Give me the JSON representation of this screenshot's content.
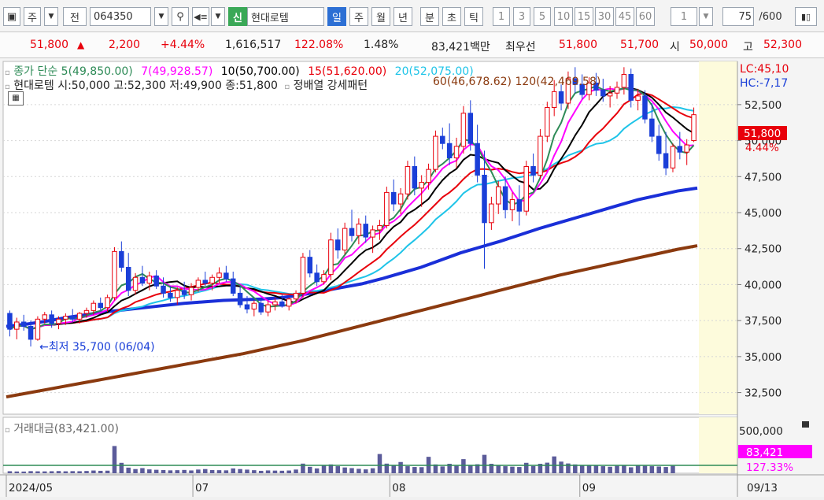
{
  "toolbar": {
    "market_label": "주",
    "jeon_label": "전",
    "code_value": "064350",
    "new_badge": "신",
    "stock_name": "현대로템",
    "periods": [
      "일",
      "주",
      "월",
      "년"
    ],
    "active_period": "일",
    "intraday": [
      "분",
      "초",
      "틱"
    ],
    "intervals": [
      "1",
      "3",
      "5",
      "10",
      "15",
      "30",
      "45",
      "60"
    ],
    "multiplier": "1",
    "count_value": "75",
    "count_total": "/600"
  },
  "quote": {
    "price": "51,800",
    "up_arrow": "▲",
    "change": "2,200",
    "change_pct": "+4.44%",
    "volume": "1,616,517",
    "vol_ratio": "122.08%",
    "turnover": "1.48%",
    "amount": "83,421백만",
    "priority_label": "최우선",
    "ask": "51,800",
    "bid": "51,700",
    "open_label": "시",
    "open": "50,000",
    "high_label": "고",
    "high": "52,300"
  },
  "legend": {
    "ma_prefix": "종가 단순",
    "ma5": "5(49,850.00)",
    "ma7": "7(49,928.57)",
    "ma10": "10(50,700.00)",
    "ma15": "15(51,620.00)",
    "ma20": "20(52,075.00)",
    "ohlc_line": "현대로템 시:50,000 고:52,300 저:49,900 종:51,800",
    "pattern_label": "정배열 강세패턴",
    "overlap_text": "60(46,678.62) 120(42,469.58)",
    "lc": "LC:45,10",
    "hc": "HC:-7,17",
    "low_annotation": "←최저 35,700 (06/04)",
    "volume_legend": "거래대금(83,421.00)"
  },
  "price_tag": {
    "value": "51,800",
    "pct": "4.44%"
  },
  "volume_tag": {
    "value": "83,421",
    "pct": "127.33%"
  },
  "axis": {
    "price_ticks": [
      "52,500",
      "50,000",
      "47,500",
      "45,000",
      "42,500",
      "40,000",
      "37,500",
      "35,000",
      "32,500"
    ],
    "volume_tick": "500,000",
    "x_ticks": [
      "2024/05",
      "07",
      "08",
      "09",
      "09/13"
    ]
  },
  "colors": {
    "up": "#e8000b",
    "down": "#1a3fd8",
    "ma5": "#2e8b57",
    "ma7": "#ff00ff",
    "ma10": "#000000",
    "ma15": "#e8000b",
    "ma20": "#1fc4e8",
    "ma60": "#1a2fd8",
    "ma120": "#8b3a0f",
    "volume": "#5b5b9a"
  },
  "chart_data": {
    "type": "candlestick",
    "x_labels": [
      "2024/05",
      "07",
      "08",
      "09",
      "09/13"
    ],
    "ylim": [
      31000,
      55500
    ],
    "price_ticks": [
      32500,
      35000,
      37500,
      40000,
      42500,
      45000,
      47500,
      50000,
      52500
    ],
    "last_candle": {
      "open": 50000,
      "high": 52300,
      "low": 49900,
      "close": 51800
    },
    "low_point": {
      "value": 35700,
      "date": "06/04"
    },
    "ma_last": {
      "ma5": 49850,
      "ma7": 49928.57,
      "ma10": 50700,
      "ma15": 51620,
      "ma20": 52075,
      "ma60": 46678.62,
      "ma120": 42469.58
    },
    "candles": [
      [
        38000,
        38200,
        36400,
        36900
      ],
      [
        36900,
        37700,
        36200,
        37400
      ],
      [
        37400,
        37900,
        36800,
        37100
      ],
      [
        37100,
        37500,
        35700,
        36200
      ],
      [
        36200,
        37800,
        36100,
        37600
      ],
      [
        37600,
        38100,
        37300,
        37900
      ],
      [
        37900,
        38200,
        37000,
        37300
      ],
      [
        37300,
        37800,
        36900,
        37600
      ],
      [
        37600,
        38000,
        37200,
        37800
      ],
      [
        37800,
        38300,
        37400,
        37600
      ],
      [
        37600,
        38100,
        37300,
        38000
      ],
      [
        38000,
        38400,
        37700,
        38200
      ],
      [
        38200,
        38900,
        37900,
        38700
      ],
      [
        38700,
        39100,
        38200,
        38400
      ],
      [
        38400,
        39300,
        38100,
        39100
      ],
      [
        39100,
        42600,
        38900,
        42300
      ],
      [
        42300,
        43000,
        40900,
        41200
      ],
      [
        41200,
        42200,
        39200,
        39600
      ],
      [
        39600,
        40800,
        39300,
        40500
      ],
      [
        40500,
        41300,
        39900,
        40100
      ],
      [
        40100,
        40900,
        39600,
        40600
      ],
      [
        40600,
        41000,
        39700,
        39900
      ],
      [
        39900,
        40500,
        39100,
        39400
      ],
      [
        39400,
        39900,
        38800,
        39100
      ],
      [
        39100,
        39800,
        38600,
        39600
      ],
      [
        39600,
        40200,
        39000,
        39300
      ],
      [
        39300,
        40100,
        38900,
        39800
      ],
      [
        39800,
        40500,
        39500,
        40300
      ],
      [
        40300,
        40900,
        39900,
        40100
      ],
      [
        40100,
        40700,
        39600,
        40500
      ],
      [
        40500,
        41200,
        40100,
        40800
      ],
      [
        40800,
        41300,
        40200,
        40400
      ],
      [
        40400,
        40900,
        39200,
        39400
      ],
      [
        39400,
        39900,
        38400,
        38600
      ],
      [
        38600,
        39200,
        38000,
        38300
      ],
      [
        38300,
        38900,
        37800,
        38700
      ],
      [
        38700,
        39100,
        37900,
        38100
      ],
      [
        38100,
        38900,
        37800,
        38600
      ],
      [
        38600,
        39100,
        38200,
        38800
      ],
      [
        38800,
        39300,
        38400,
        38500
      ],
      [
        38500,
        39100,
        38200,
        39000
      ],
      [
        39000,
        39600,
        38700,
        39400
      ],
      [
        39400,
        42200,
        39100,
        41900
      ],
      [
        41900,
        42400,
        40500,
        40800
      ],
      [
        40800,
        41400,
        39900,
        40200
      ],
      [
        40200,
        41000,
        40000,
        40700
      ],
      [
        40700,
        43600,
        40300,
        43100
      ],
      [
        43100,
        43900,
        41800,
        42400
      ],
      [
        42400,
        44300,
        42100,
        43900
      ],
      [
        43900,
        45200,
        43000,
        43400
      ],
      [
        43400,
        44600,
        42800,
        44200
      ],
      [
        44200,
        44800,
        42900,
        43300
      ],
      [
        43300,
        44100,
        42200,
        43800
      ],
      [
        43800,
        44500,
        43100,
        44100
      ],
      [
        44100,
        46800,
        43900,
        46400
      ],
      [
        46400,
        47300,
        45100,
        45600
      ],
      [
        45600,
        46700,
        44900,
        46300
      ],
      [
        46300,
        48600,
        45900,
        48200
      ],
      [
        48200,
        48900,
        46200,
        46700
      ],
      [
        46700,
        47600,
        45400,
        47100
      ],
      [
        47100,
        48400,
        46600,
        48000
      ],
      [
        48000,
        50700,
        47800,
        50300
      ],
      [
        50300,
        50900,
        49400,
        49800
      ],
      [
        49800,
        51200,
        48300,
        48800
      ],
      [
        48800,
        50200,
        48100,
        49600
      ],
      [
        49600,
        52400,
        49100,
        51900
      ],
      [
        51900,
        52800,
        49300,
        49800
      ],
      [
        49800,
        51100,
        47100,
        47600
      ],
      [
        47600,
        49300,
        41100,
        44300
      ],
      [
        44300,
        46100,
        43800,
        45600
      ],
      [
        45600,
        47200,
        44900,
        46800
      ],
      [
        46800,
        47500,
        44600,
        45200
      ],
      [
        45200,
        46400,
        44400,
        45900
      ],
      [
        45900,
        46900,
        44100,
        45100
      ],
      [
        45100,
        48600,
        44800,
        48200
      ],
      [
        48200,
        49100,
        47100,
        47600
      ],
      [
        47600,
        50800,
        47300,
        50300
      ],
      [
        50300,
        52700,
        49900,
        52300
      ],
      [
        52300,
        54200,
        51700,
        53400
      ],
      [
        53400,
        53900,
        52100,
        52600
      ],
      [
        52600,
        54800,
        52200,
        54300
      ],
      [
        54300,
        55100,
        53300,
        53900
      ],
      [
        53900,
        54600,
        52900,
        53200
      ],
      [
        53200,
        54400,
        52800,
        54000
      ],
      [
        54000,
        54700,
        53100,
        53500
      ],
      [
        53500,
        54300,
        52700,
        53100
      ],
      [
        53100,
        53800,
        52300,
        53300
      ],
      [
        53300,
        54100,
        52900,
        53700
      ],
      [
        53700,
        55100,
        53200,
        54600
      ],
      [
        54600,
        55000,
        52300,
        52800
      ],
      [
        52800,
        53600,
        52100,
        53100
      ],
      [
        53100,
        53500,
        51200,
        51500
      ],
      [
        51500,
        52600,
        49900,
        50300
      ],
      [
        50300,
        51100,
        48600,
        49100
      ],
      [
        49100,
        50600,
        47600,
        48100
      ],
      [
        48100,
        49800,
        47800,
        49600
      ],
      [
        49600,
        50600,
        48700,
        49200
      ],
      [
        49200,
        50100,
        48300,
        49700
      ],
      [
        50000,
        52300,
        49900,
        51800
      ]
    ],
    "ma60": [
      37100,
      37250,
      37450,
      37700,
      37900,
      38100,
      38250,
      38400,
      38550,
      38700,
      38800,
      38900,
      38950,
      39000,
      39100,
      39300,
      39550,
      39800,
      40050,
      40400,
      40800,
      41200,
      41700,
      42200,
      42600,
      43000,
      43450,
      43900,
      44300,
      44700,
      45100,
      45500,
      45900,
      46200,
      46500,
      46700
    ],
    "ma120": [
      32200,
      32450,
      32700,
      32950,
      33200,
      33450,
      33700,
      33950,
      34200,
      34450,
      34700,
      34950,
      35200,
      35500,
      35800,
      36100,
      36450,
      36800,
      37150,
      37500,
      37850,
      38200,
      38550,
      38900,
      39250,
      39600,
      39950,
      40300,
      40650,
      40950,
      41250,
      41550,
      41850,
      42150,
      42450,
      42700
    ],
    "volume_max": 600000,
    "volumes": [
      25000,
      22000,
      21000,
      26000,
      24000,
      23000,
      25000,
      27000,
      24000,
      26000,
      25000,
      28000,
      34000,
      30000,
      32000,
      340000,
      130000,
      70000,
      52000,
      64000,
      48000,
      43000,
      40000,
      36000,
      38000,
      41000,
      35000,
      46000,
      52000,
      40000,
      38000,
      36000,
      60000,
      52000,
      45000,
      38000,
      30000,
      35000,
      33000,
      31000,
      34000,
      46000,
      120000,
      80000,
      60000,
      95000,
      110000,
      88000,
      72000,
      64000,
      55000,
      48000,
      62000,
      240000,
      120000,
      95000,
      140000,
      88000,
      78000,
      76000,
      205000,
      110000,
      85000,
      118000,
      92000,
      176000,
      104000,
      112000,
      230000,
      118000,
      96000,
      88000,
      82000,
      78000,
      130000,
      90000,
      118000,
      132000,
      210000,
      145000,
      122000,
      110000,
      96000,
      102000,
      94000,
      88000,
      81000,
      92000,
      98000,
      74000,
      102000,
      92000,
      88000,
      84000,
      78000,
      92000
    ]
  }
}
